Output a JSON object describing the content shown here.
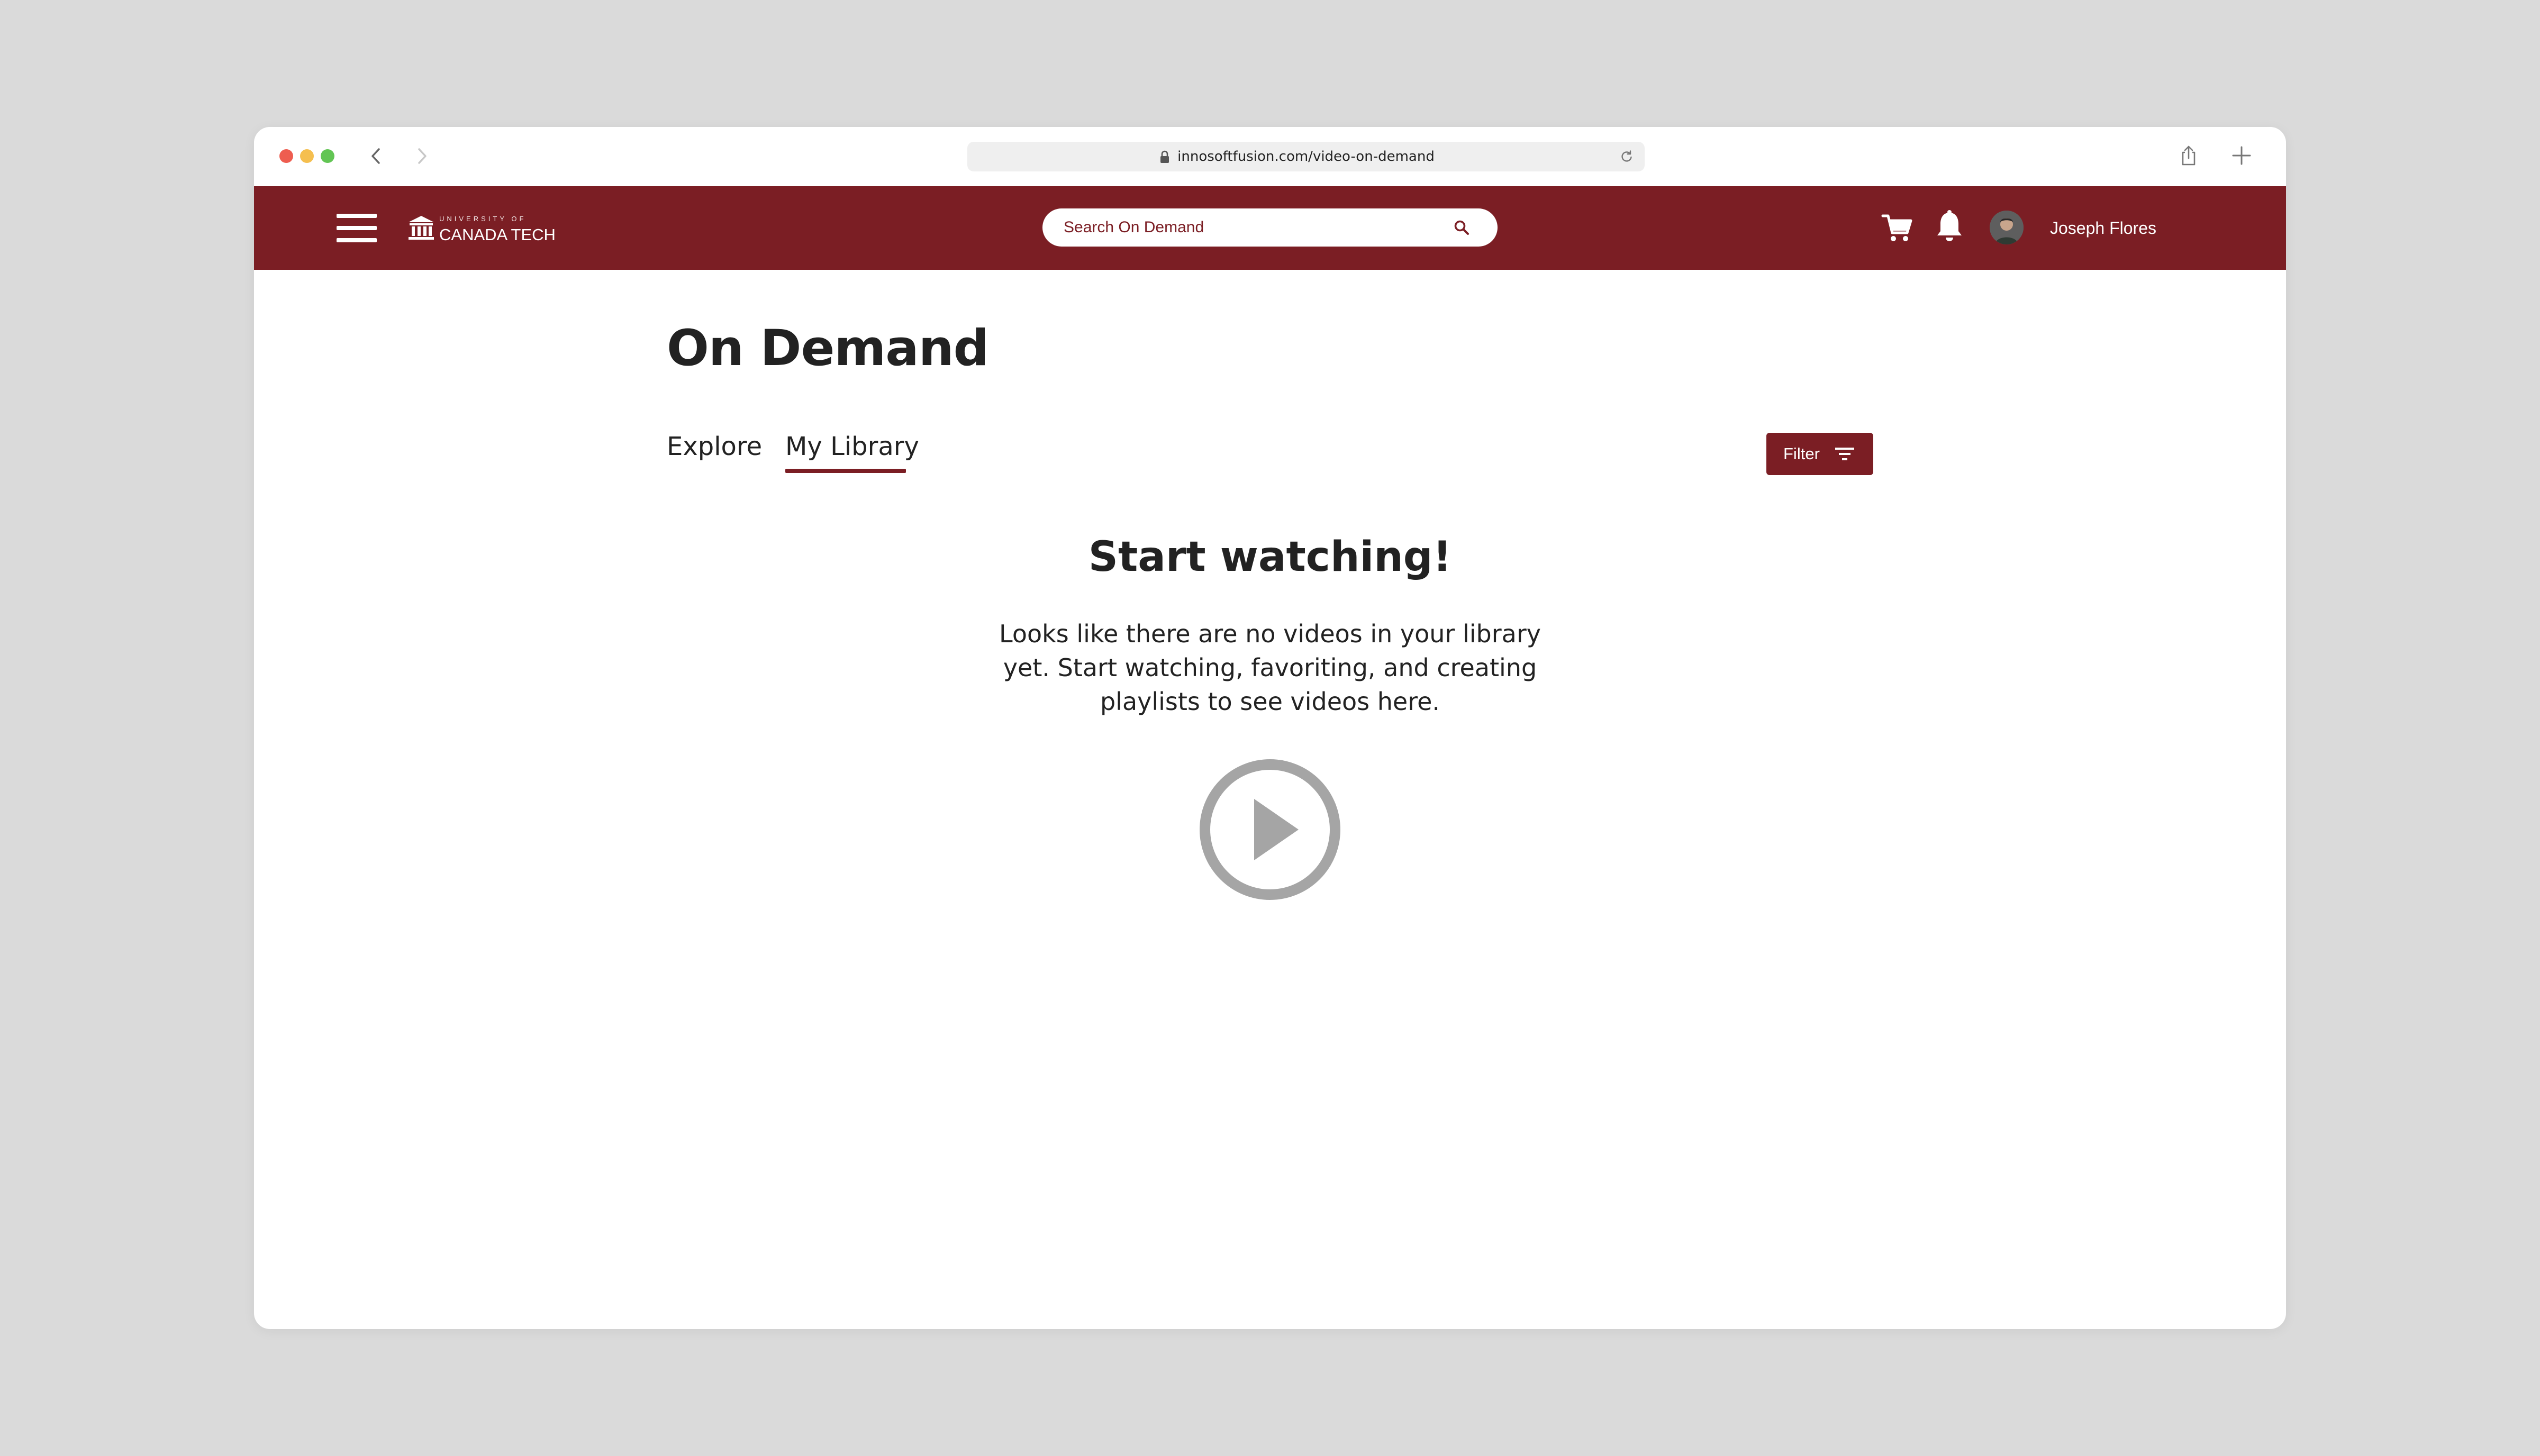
{
  "browser": {
    "url": "innosoftfusion.com/video-on-demand"
  },
  "header": {
    "logo_small": "UNIVERSITY OF",
    "logo_main": "CANADA TECH",
    "search_placeholder": "Search On Demand",
    "user_name": "Joseph Flores"
  },
  "main": {
    "title": "On Demand",
    "tabs": [
      {
        "label": "Explore",
        "active": false
      },
      {
        "label": "My Library",
        "active": true
      }
    ],
    "filter_label": "Filter",
    "empty_state": {
      "title": "Start watching!",
      "message": "Looks like there are no videos in your library yet. Start watching, favoriting, and creating playlists to see videos here."
    }
  },
  "colors": {
    "brand": "#7b1e24",
    "background": "#dadada",
    "play_icon": "#a5a5a5"
  },
  "icons": [
    "lock-icon",
    "reload-icon",
    "share-icon",
    "new-tab-icon",
    "menu-icon",
    "university-logo-icon",
    "search-icon",
    "cart-icon",
    "bell-icon",
    "filter-icon",
    "play-icon"
  ]
}
